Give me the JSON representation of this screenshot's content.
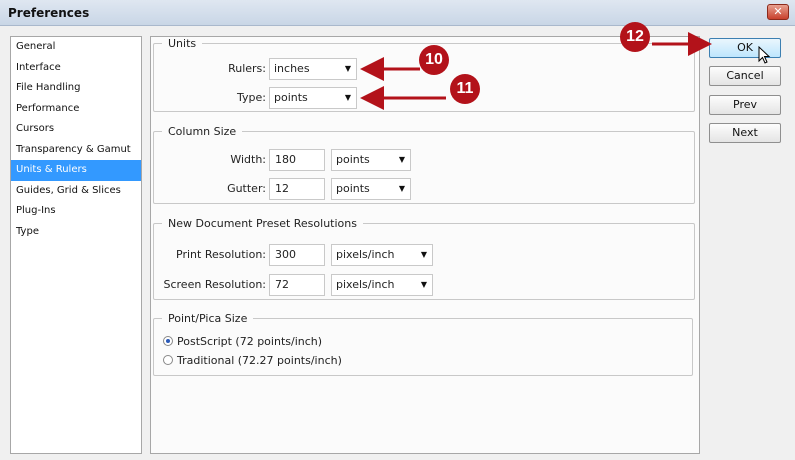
{
  "window": {
    "title": "Preferences",
    "close_glyph": "✕"
  },
  "sidebar": {
    "items": [
      {
        "label": "General"
      },
      {
        "label": "Interface"
      },
      {
        "label": "File Handling"
      },
      {
        "label": "Performance"
      },
      {
        "label": "Cursors"
      },
      {
        "label": "Transparency & Gamut"
      },
      {
        "label": "Units & Rulers",
        "selected": true
      },
      {
        "label": "Guides, Grid & Slices"
      },
      {
        "label": "Plug-Ins"
      },
      {
        "label": "Type"
      }
    ]
  },
  "units": {
    "legend": "Units",
    "rulers_label": "Rulers:",
    "rulers_value": "inches",
    "type_label": "Type:",
    "type_value": "points"
  },
  "column_size": {
    "legend": "Column Size",
    "width_label": "Width:",
    "width_value": "180",
    "width_unit": "points",
    "gutter_label": "Gutter:",
    "gutter_value": "12",
    "gutter_unit": "points"
  },
  "resolutions": {
    "legend": "New Document Preset Resolutions",
    "print_label": "Print Resolution:",
    "print_value": "300",
    "print_unit": "pixels/inch",
    "screen_label": "Screen Resolution:",
    "screen_value": "72",
    "screen_unit": "pixels/inch"
  },
  "point_pica": {
    "legend": "Point/Pica Size",
    "options": [
      {
        "label": "PostScript (72 points/inch)",
        "checked": true
      },
      {
        "label": "Traditional (72.27 points/inch)",
        "checked": false
      }
    ]
  },
  "buttons": {
    "ok": "OK",
    "cancel": "Cancel",
    "prev": "Prev",
    "next": "Next"
  },
  "callouts": [
    "10",
    "11",
    "12"
  ],
  "colors": {
    "callout": "#b3121a",
    "selection": "#3399ff"
  }
}
